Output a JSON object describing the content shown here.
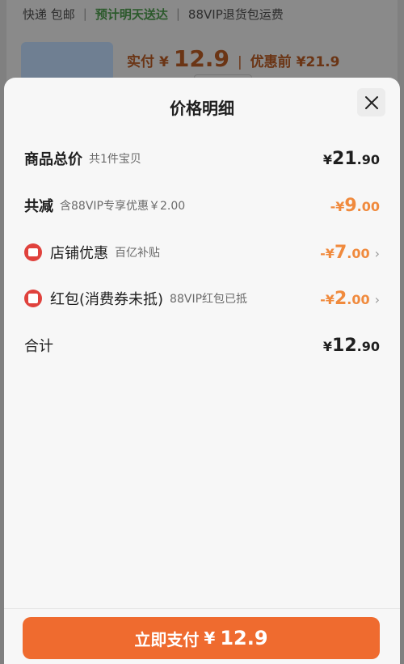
{
  "background": {
    "shipping_text": "快递 包邮",
    "delivery_promo": "预计明天送达",
    "return_text": "88VIP退货包运费",
    "price_paid_label": "实付",
    "price_paid_currency": "¥",
    "price_paid_value": "12.9",
    "price_before_label": "优惠前",
    "price_before_value": "¥21.9"
  },
  "sheet": {
    "title": "价格明细",
    "close_icon": "close-icon",
    "rows": [
      {
        "label": "商品总价",
        "sub": "共1件宝贝",
        "currency": "¥",
        "int": "21",
        "dec": ".90"
      },
      {
        "label": "共减",
        "sub": "含88VIP专享优惠￥2.00",
        "currency": "-¥",
        "int": "9",
        "dec": ".00"
      },
      {
        "label": "店铺优惠",
        "sub": "百亿补贴",
        "currency": "-¥",
        "int": "7",
        "dec": ".00"
      },
      {
        "label": "红包(消费券未抵)",
        "sub": "88VIP红包已抵",
        "currency": "-¥",
        "int": "2",
        "dec": ".00"
      },
      {
        "label": "合计",
        "sub": "",
        "currency": "¥",
        "int": "12",
        "dec": ".90"
      }
    ]
  },
  "footer": {
    "pay_label": "立即支付",
    "pay_currency": "¥",
    "pay_amount": "12.9"
  },
  "colors": {
    "accent": "#ef6b2f",
    "discount": "#f08a3d",
    "badge_red": "#e0423d"
  }
}
